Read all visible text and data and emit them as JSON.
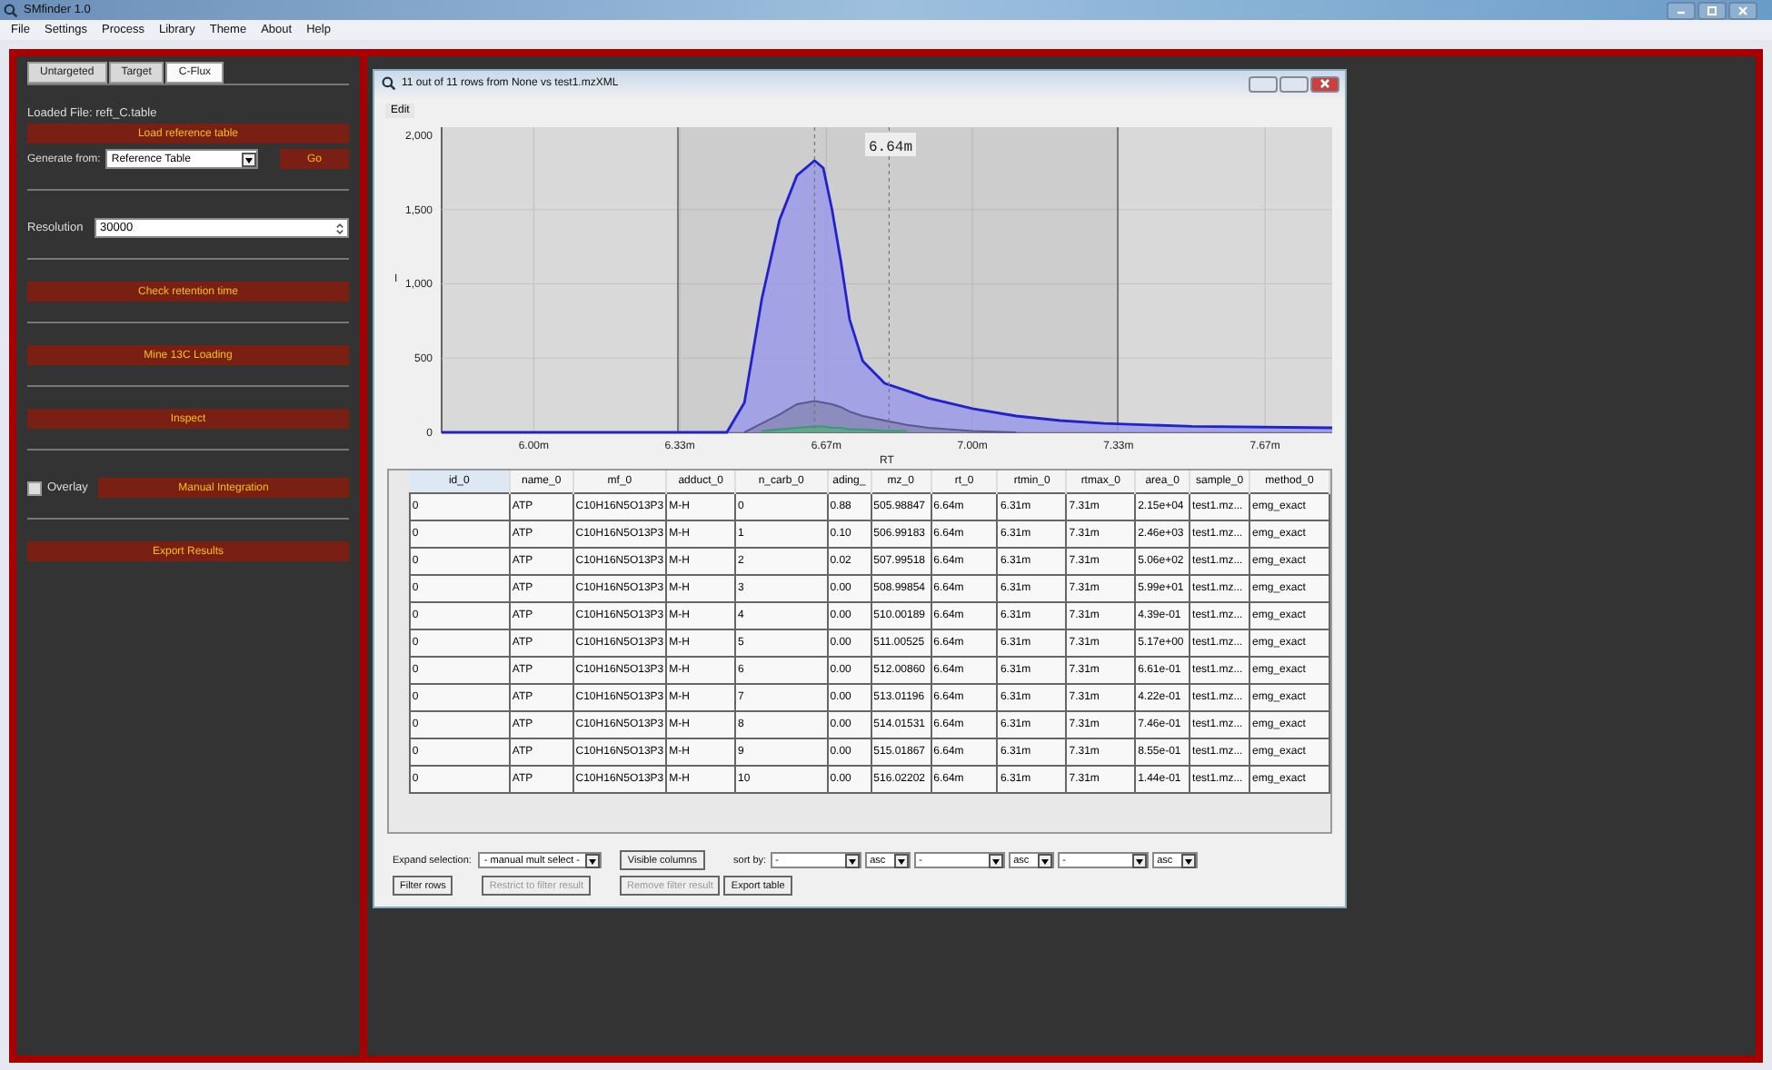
{
  "app_title": "SMfinder 1.0",
  "menu": [
    "File",
    "Settings",
    "Process",
    "Library",
    "Theme",
    "About",
    "Help"
  ],
  "tabs": [
    {
      "label": "Untargeted",
      "selected": false
    },
    {
      "label": "Target",
      "selected": false
    },
    {
      "label": "C-Flux",
      "selected": true
    }
  ],
  "loaded_file": "Loaded File:  reft_C.table",
  "panel": [
    {
      "kind": "button",
      "label": "Load reference table"
    },
    {
      "kind": "generate",
      "label": "Generate from:",
      "value": "Reference Table",
      "button": "Go"
    },
    {
      "kind": "divider"
    },
    {
      "kind": "input",
      "label": "Resolution",
      "value": "30000"
    },
    {
      "kind": "divider"
    },
    {
      "kind": "button",
      "label": "Check retention time"
    },
    {
      "kind": "divider"
    },
    {
      "kind": "button",
      "label": "Mine 13C Loading"
    },
    {
      "kind": "divider"
    },
    {
      "kind": "button",
      "label": "Inspect"
    },
    {
      "kind": "divider"
    },
    {
      "kind": "checkbutton",
      "label": "Overlay",
      "checked": false,
      "button": "Manual Integration"
    },
    {
      "kind": "divider"
    },
    {
      "kind": "button",
      "label": "Export Results"
    }
  ],
  "window": {
    "title": "11 out of 11 rows from None vs test1.mzXML",
    "menu": [
      "Edit"
    ]
  },
  "plot": {
    "marker": "6.64m"
  },
  "chart_data": {
    "type": "area",
    "grid": true,
    "xlabel": "RT",
    "ylabel": "I",
    "x": [
      5.79,
      6.44,
      6.48,
      6.52,
      6.56,
      6.6,
      6.64,
      6.66,
      6.68,
      6.7,
      6.72,
      6.75,
      6.8,
      6.85,
      6.9,
      7.0,
      7.1,
      7.2,
      7.3,
      7.5,
      7.82
    ],
    "series": [
      {
        "color": "#2222cc",
        "values": [
          0,
          0,
          200,
          900,
          1430,
          1730,
          1830,
          1780,
          1500,
          1150,
          760,
          480,
          330,
          280,
          230,
          160,
          110,
          80,
          60,
          40,
          30
        ]
      },
      {
        "color": "#5a5890",
        "values": [
          null,
          null,
          0,
          60,
          120,
          190,
          210,
          200,
          190,
          170,
          140,
          110,
          80,
          50,
          30,
          10,
          0,
          null,
          null,
          null,
          null
        ]
      },
      {
        "color": "#3a9a70",
        "values": [
          null,
          null,
          null,
          10,
          20,
          30,
          40,
          40,
          30,
          30,
          20,
          20,
          10,
          10,
          null,
          null,
          null,
          null,
          null,
          null,
          null
        ]
      }
    ],
    "xlim": [
      5.79,
      7.82
    ],
    "ylim": [
      0,
      2055
    ],
    "ref_lines": [
      {
        "axis": "x",
        "value": 6.64
      },
      {
        "axis": "x",
        "value": 6.81
      }
    ],
    "xticks": [
      {
        "value": 6.0,
        "label": "6.00m"
      },
      {
        "value": 6.333,
        "label": "6.33m"
      },
      {
        "value": 6.667,
        "label": "6.67m"
      },
      {
        "value": 7.0,
        "label": "7.00m"
      },
      {
        "value": 7.333,
        "label": "7.33m"
      },
      {
        "value": 7.667,
        "label": "7.67m"
      }
    ],
    "yticks": [
      {
        "value": 0,
        "label": "0"
      },
      {
        "value": 500,
        "label": "500"
      },
      {
        "value": 1000,
        "label": "1,000"
      },
      {
        "value": 1500,
        "label": "1,500"
      },
      {
        "value": 2000,
        "label": "2,000"
      }
    ]
  },
  "table": {
    "columns": [
      "id_0",
      "name_0",
      "mf_0",
      "adduct_0",
      "n_carb_0",
      "ading_",
      "mz_0",
      "rt_0",
      "rtmin_0",
      "rtmax_0",
      "area_0",
      "sample_0",
      "method_0"
    ],
    "rows": [
      [
        "0",
        "ATP",
        "C10H16N5O13P3",
        "M-H",
        "0",
        "0.88",
        "505.98847",
        "6.64m",
        "6.31m",
        "7.31m",
        "2.15e+04",
        "test1.mz...",
        "emg_exact"
      ],
      [
        "0",
        "ATP",
        "C10H16N5O13P3",
        "M-H",
        "1",
        "0.10",
        "506.99183",
        "6.64m",
        "6.31m",
        "7.31m",
        "2.46e+03",
        "test1.mz...",
        "emg_exact"
      ],
      [
        "0",
        "ATP",
        "C10H16N5O13P3",
        "M-H",
        "2",
        "0.02",
        "507.99518",
        "6.64m",
        "6.31m",
        "7.31m",
        "5.06e+02",
        "test1.mz...",
        "emg_exact"
      ],
      [
        "0",
        "ATP",
        "C10H16N5O13P3",
        "M-H",
        "3",
        "0.00",
        "508.99854",
        "6.64m",
        "6.31m",
        "7.31m",
        "5.99e+01",
        "test1.mz...",
        "emg_exact"
      ],
      [
        "0",
        "ATP",
        "C10H16N5O13P3",
        "M-H",
        "4",
        "0.00",
        "510.00189",
        "6.64m",
        "6.31m",
        "7.31m",
        "4.39e-01",
        "test1.mz...",
        "emg_exact"
      ],
      [
        "0",
        "ATP",
        "C10H16N5O13P3",
        "M-H",
        "5",
        "0.00",
        "511.00525",
        "6.64m",
        "6.31m",
        "7.31m",
        "5.17e+00",
        "test1.mz...",
        "emg_exact"
      ],
      [
        "0",
        "ATP",
        "C10H16N5O13P3",
        "M-H",
        "6",
        "0.00",
        "512.00860",
        "6.64m",
        "6.31m",
        "7.31m",
        "6.61e-01",
        "test1.mz...",
        "emg_exact"
      ],
      [
        "0",
        "ATP",
        "C10H16N5O13P3",
        "M-H",
        "7",
        "0.00",
        "513.01196",
        "6.64m",
        "6.31m",
        "7.31m",
        "4.22e-01",
        "test1.mz...",
        "emg_exact"
      ],
      [
        "0",
        "ATP",
        "C10H16N5O13P3",
        "M-H",
        "8",
        "0.00",
        "514.01531",
        "6.64m",
        "6.31m",
        "7.31m",
        "7.46e-01",
        "test1.mz...",
        "emg_exact"
      ],
      [
        "0",
        "ATP",
        "C10H16N5O13P3",
        "M-H",
        "9",
        "0.00",
        "515.01867",
        "6.64m",
        "6.31m",
        "7.31m",
        "8.55e-01",
        "test1.mz...",
        "emg_exact"
      ],
      [
        "0",
        "ATP",
        "C10H16N5O13P3",
        "M-H",
        "10",
        "0.00",
        "516.02202",
        "6.64m",
        "6.31m",
        "7.31m",
        "1.44e-01",
        "test1.mz...",
        "emg_exact"
      ]
    ]
  },
  "controls": {
    "expand_label": "Expand selection:",
    "expand_value": "- manual mult select -",
    "visible_columns": "Visible columns",
    "sort_label": "sort by:",
    "sorts": [
      {
        "field": "-",
        "order": "asc"
      },
      {
        "field": "-",
        "order": "asc"
      },
      {
        "field": "-",
        "order": "asc"
      }
    ],
    "buttons": [
      {
        "label": "Filter rows",
        "disabled": false
      },
      {
        "label": "Restrict to filter result",
        "disabled": true
      },
      {
        "label": "Remove filter result",
        "disabled": true
      },
      {
        "label": "Export table",
        "disabled": false
      }
    ]
  }
}
